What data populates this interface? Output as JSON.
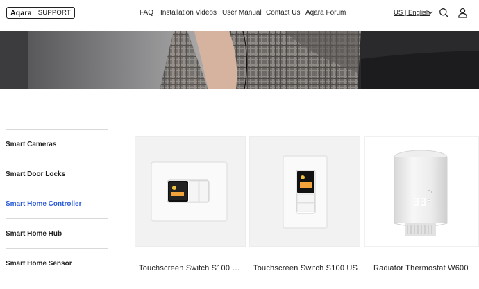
{
  "header": {
    "logo_brand": "Aqara",
    "logo_support": "SUPPORT",
    "nav": [
      "FAQ",
      "Installation Videos",
      "User Manual",
      "Contact Us",
      "Aqara Forum"
    ],
    "language": "US | English",
    "icons": {
      "language_toggle": "chevron-down-icon",
      "search": "search-icon",
      "account": "user-icon"
    }
  },
  "sidebar": {
    "items": [
      {
        "label": "Smart Cameras",
        "active": false
      },
      {
        "label": "Smart Door Locks",
        "active": false
      },
      {
        "label": "Smart Home Controller",
        "active": true
      },
      {
        "label": "Smart Home Hub",
        "active": false
      },
      {
        "label": "Smart Home Sensor",
        "active": false
      }
    ]
  },
  "products": [
    {
      "title": "Touchscreen Switch S100 H..."
    },
    {
      "title": "Touchscreen Switch S100 US"
    },
    {
      "title": "Radiator Thermostat W600"
    }
  ],
  "colors": {
    "accent": "#2a5bd7",
    "text": "#222222",
    "divider": "#d9d9d9",
    "card_bg": "#f2f2f2"
  }
}
